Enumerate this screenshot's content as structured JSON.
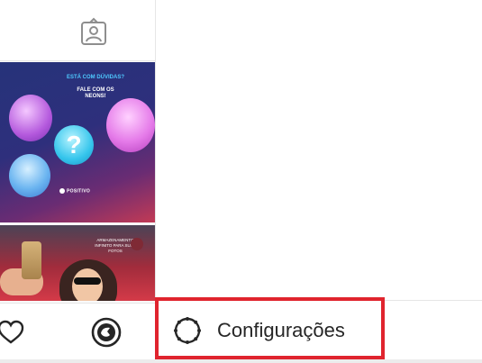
{
  "feed": {
    "post1": {
      "small_text": "ESTÁ COM DÚVIDAS?",
      "big_text": "FALE COM OS NEONS!",
      "question_mark": "?",
      "brand": "POSITIVO"
    },
    "post2": {
      "text": "ARMAZENAMENTO INFINITO PARA SUAS FOTOS"
    }
  },
  "bottom_nav": {
    "icons": [
      "heart-icon",
      "profile-icon"
    ]
  },
  "drawer": {
    "settings_label": "Configurações",
    "settings_icon": "gear-icon"
  },
  "colors": {
    "highlight": "#e0242e",
    "text": "#262626",
    "divider": "#e6e6e6"
  }
}
